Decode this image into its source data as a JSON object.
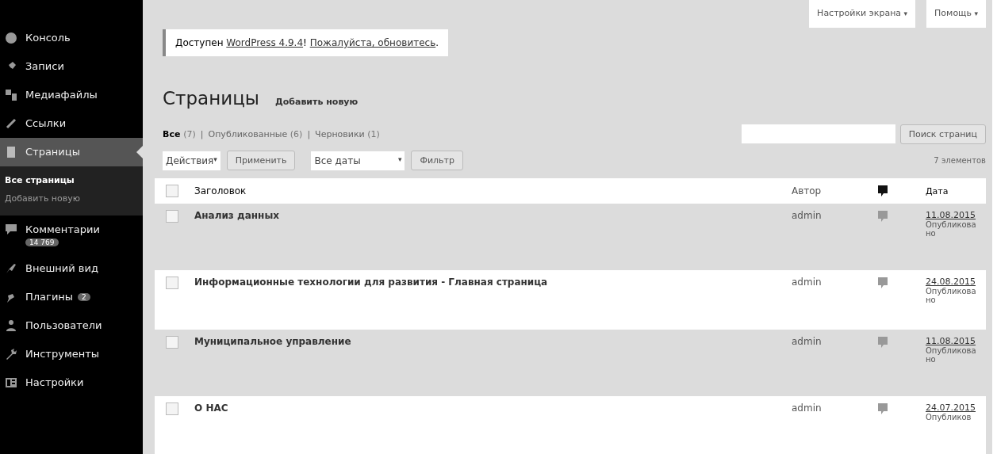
{
  "sidebar": {
    "items": [
      {
        "label": "Консоль",
        "selected": false
      },
      {
        "label": "Записи",
        "selected": false
      },
      {
        "label": "Медиафайлы",
        "selected": false
      },
      {
        "label": "Ссылки",
        "selected": false
      },
      {
        "label": "Страницы",
        "selected": true,
        "children": [
          {
            "label": "Все страницы",
            "selected": true
          },
          {
            "label": "Добавить новую",
            "selected": false
          }
        ]
      },
      {
        "label": "Комментарии",
        "selected": false,
        "badge": "14 769",
        "badge_below": true
      },
      {
        "label": "Внешний вид",
        "selected": false
      },
      {
        "label": "Плагины",
        "selected": false,
        "badge": "2",
        "badge_below": false
      },
      {
        "label": "Пользователи",
        "selected": false
      },
      {
        "label": "Инструменты",
        "selected": false
      },
      {
        "label": "Настройки",
        "selected": false
      }
    ]
  },
  "top_tabs": [
    {
      "label": "Настройки экрана",
      "caret": "▾"
    },
    {
      "label": "Помощь",
      "caret": "▾"
    }
  ],
  "notice": {
    "text": "Доступен ",
    "link1": "WordPress 4.9.4",
    "sep": "! ",
    "link2": "Пожалуйста, обновитесь",
    "end": "."
  },
  "heading": "Страницы",
  "add_new": "Добавить новую",
  "filters": [
    {
      "label": "Все",
      "count": "(7)",
      "selected": true
    },
    {
      "separator": "|",
      "label": "Опубликованные",
      "count": "(6)",
      "selected": false
    },
    {
      "separator": "|",
      "label": "Черновики",
      "count": "(1)",
      "selected": false
    }
  ],
  "search": {
    "button": "Поиск страниц"
  },
  "toolbar": {
    "actions": "Действия",
    "actions_caret": "▾",
    "apply": "Применить",
    "dates": "Все даты",
    "dates_caret": "▾",
    "filter": "Фильтр",
    "count": "7 элементов"
  },
  "table": {
    "columns": [
      "Заголовок",
      "Автор",
      "Дата"
    ],
    "select_all_checked": false,
    "rows": [
      {
        "title": "Анализ данных",
        "author": "admin",
        "date": "11.08.2015",
        "status": "Опубликовано",
        "checked": false
      },
      {
        "title": "Информационные технологии для развития - Главная страница",
        "author": "admin",
        "date": "24.08.2015",
        "status": "Опубликовано",
        "checked": false
      },
      {
        "title": "Муниципальное управление",
        "author": "admin",
        "date": "11.08.2015",
        "status": "Опубликовано",
        "checked": false
      },
      {
        "title": "О НАС",
        "author": "admin",
        "date": "24.07.2015",
        "status": "Опубликов",
        "checked": false
      }
    ]
  }
}
